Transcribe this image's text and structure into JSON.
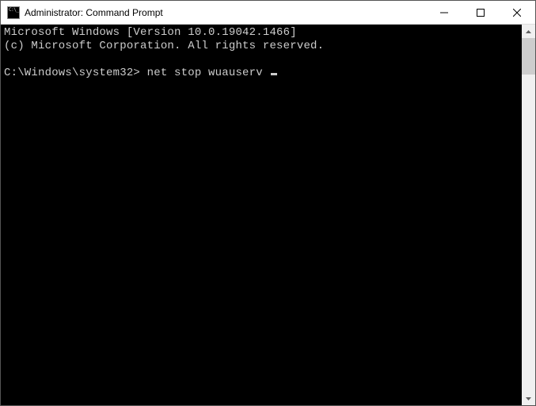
{
  "window": {
    "title": "Administrator: Command Prompt"
  },
  "terminal": {
    "line1": "Microsoft Windows [Version 10.0.19042.1466]",
    "line2": "(c) Microsoft Corporation. All rights reserved.",
    "blank": "",
    "prompt": "C:\\Windows\\system32>",
    "command": "net stop wuauserv"
  }
}
